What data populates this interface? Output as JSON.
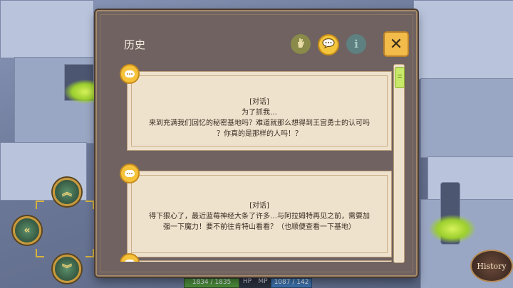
{
  "dialog": {
    "title": "历史",
    "filter_icon": "hand-filter-icon",
    "dialogue_icon": "speech-bubble-icon",
    "info_icon": "info-icon",
    "info_glyph": "i",
    "close_glyph": "✕"
  },
  "entries": [
    {
      "icon": "speech-bubble-icon",
      "header": "[对话]",
      "lines": [
        "为了抓我…",
        "来到充满我们回忆的秘密基地吗？难道就那么想得到王宫勇士的认可吗",
        "？你真的是那样的人吗！？"
      ]
    },
    {
      "icon": "speech-bubble-icon",
      "header": "[对话]",
      "lines": [
        "得下狠心了，最近蓝莓神经大条了许多…与阿拉姆特再见之前，需要加",
        "强一下魔力！要不前往肯特山看看？（也顺便查看一下基地）"
      ]
    }
  ],
  "hud": {
    "hp_value": "1834 / 1835",
    "hp_label": "HP",
    "mp_label": "MP",
    "mp_value": "1087 / 142"
  },
  "history_button": "History",
  "colors": {
    "accent_yellow": "#f3c53c",
    "panel_bg": "#6f6260",
    "entry_bg": "#efe2cd",
    "scroll_thumb": "#c8e86a"
  }
}
